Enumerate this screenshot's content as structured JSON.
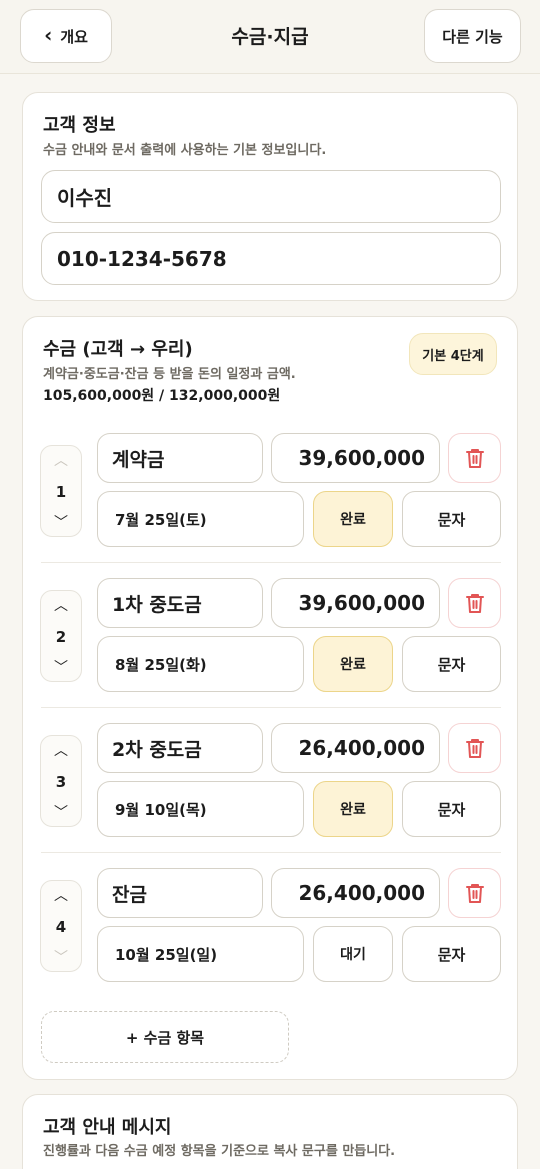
{
  "header": {
    "back_label": "개요",
    "title": "수금·지급",
    "more_label": "다른 기능"
  },
  "customer": {
    "title": "고객 정보",
    "subtitle": "수금 안내와 문서 출력에 사용하는 기본 정보입니다.",
    "name": "이수진",
    "phone": "010-1234-5678"
  },
  "collection": {
    "title": "수금 (고객 → 우리)",
    "subtitle": "계약금·중도금·잔금 등 받을 돈의 일정과 금액.",
    "total": "105,600,000원 / 132,000,000원",
    "badge": "기본 4단계",
    "items": [
      {
        "order": "1",
        "name": "계약금",
        "amount": "39,600,000",
        "date": "7월 25일(토)",
        "status": "완료",
        "sms": "문자"
      },
      {
        "order": "2",
        "name": "1차 중도금",
        "amount": "39,600,000",
        "date": "8월 25일(화)",
        "status": "완료",
        "sms": "문자"
      },
      {
        "order": "3",
        "name": "2차 중도금",
        "amount": "26,400,000",
        "date": "9월 10일(목)",
        "status": "완료",
        "sms": "문자"
      },
      {
        "order": "4",
        "name": "잔금",
        "amount": "26,400,000",
        "date": "10월 25일(일)",
        "status": "대기",
        "sms": "문자"
      }
    ],
    "add_label": "+ 수금 항목"
  },
  "message": {
    "title": "고객 안내 메시지",
    "subtitle": "진행률과 다음 수금 예정 항목을 기준으로 복사 문구를 만듭니다."
  },
  "colors": {
    "background": "#f8f6f1",
    "done_fill": "#fdf3d6",
    "done_border": "#ecd58a",
    "delete_red": "#e25555"
  },
  "icons": {
    "back": "chevron-left-icon",
    "delete": "trash-icon",
    "up": "chevron-up-icon",
    "down": "chevron-down-icon"
  }
}
